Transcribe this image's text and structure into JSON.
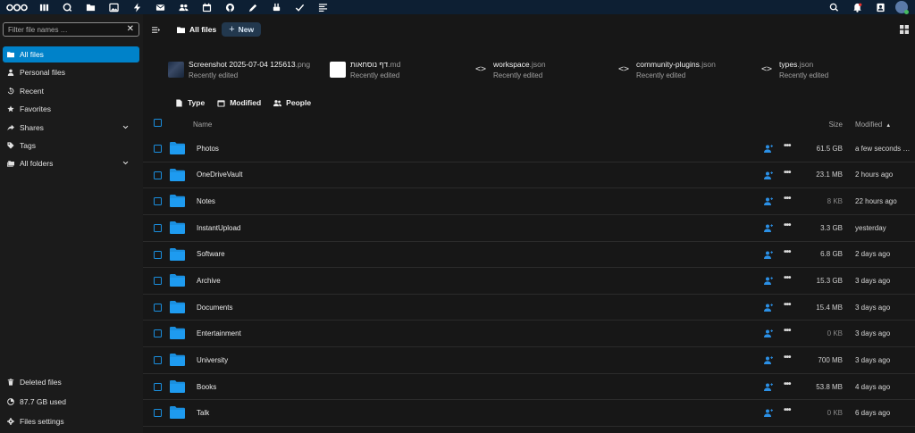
{
  "topbar": {
    "apps": [
      "logo-icon",
      "dashboard-icon",
      "search-app-icon",
      "files-icon",
      "photos-icon",
      "activity-icon",
      "mail-icon",
      "contacts-icon",
      "calendar-icon",
      "github-icon",
      "notes-icon",
      "plugins-icon",
      "tasks-icon",
      "text-icon"
    ],
    "right": [
      "search-icon",
      "notifications-icon",
      "contacts-menu-icon"
    ]
  },
  "sidebar": {
    "filter_placeholder": "Filter file names …",
    "items": [
      {
        "label": "All files",
        "icon": "folder-icon",
        "active": true
      },
      {
        "label": "Personal files",
        "icon": "person-icon"
      },
      {
        "label": "Recent",
        "icon": "history-icon"
      },
      {
        "label": "Favorites",
        "icon": "star-icon"
      },
      {
        "label": "Shares",
        "icon": "share-icon",
        "expandable": true
      },
      {
        "label": "Tags",
        "icon": "tag-icon"
      },
      {
        "label": "All folders",
        "icon": "folder-multiple-icon",
        "expandable": true
      }
    ],
    "bottom": {
      "deleted": "Deleted files",
      "quota": "87.7 GB used",
      "settings": "Files settings"
    }
  },
  "main": {
    "crumb": "All files",
    "new_label": "New",
    "recent": [
      {
        "name": "Screenshot 2025-07-04 125613",
        "ext": ".png",
        "sub": "Recently edited",
        "thumb": "image"
      },
      {
        "name": "דף נוסחאות",
        "ext": ".md",
        "sub": "Recently edited",
        "thumb": "blank"
      },
      {
        "name": "workspace",
        "ext": ".json",
        "sub": "Recently edited",
        "thumb": "code"
      },
      {
        "name": "community-plugins",
        "ext": ".json",
        "sub": "Recently edited",
        "thumb": "code"
      },
      {
        "name": "types",
        "ext": ".json",
        "sub": "Recently edited",
        "thumb": "code"
      }
    ],
    "filters": {
      "type": "Type",
      "modified": "Modified",
      "people": "People"
    },
    "columns": {
      "name": "Name",
      "size": "Size",
      "modified": "Modified"
    },
    "files": [
      {
        "name": "Photos",
        "size": "61.5 GB",
        "modified": "a few seconds ago"
      },
      {
        "name": "OneDriveVault",
        "size": "23.1 MB",
        "modified": "2 hours ago"
      },
      {
        "name": "Notes",
        "size": "8 KB",
        "modified": "22 hours ago"
      },
      {
        "name": "InstantUpload",
        "size": "3.3 GB",
        "modified": "yesterday"
      },
      {
        "name": "Software",
        "size": "6.8 GB",
        "modified": "2 days ago"
      },
      {
        "name": "Archive",
        "size": "15.3 GB",
        "modified": "3 days ago"
      },
      {
        "name": "Documents",
        "size": "15.4 MB",
        "modified": "3 days ago"
      },
      {
        "name": "Entertainment",
        "size": "0 KB",
        "modified": "3 days ago"
      },
      {
        "name": "University",
        "size": "700 MB",
        "modified": "3 days ago"
      },
      {
        "name": "Books",
        "size": "53.8 MB",
        "modified": "4 days ago"
      },
      {
        "name": "Talk",
        "size": "0 KB",
        "modified": "6 days ago"
      }
    ]
  },
  "colors": {
    "accent": "#0082c9",
    "topbar": "#0d1f33",
    "folder": "#1a8fdf"
  }
}
